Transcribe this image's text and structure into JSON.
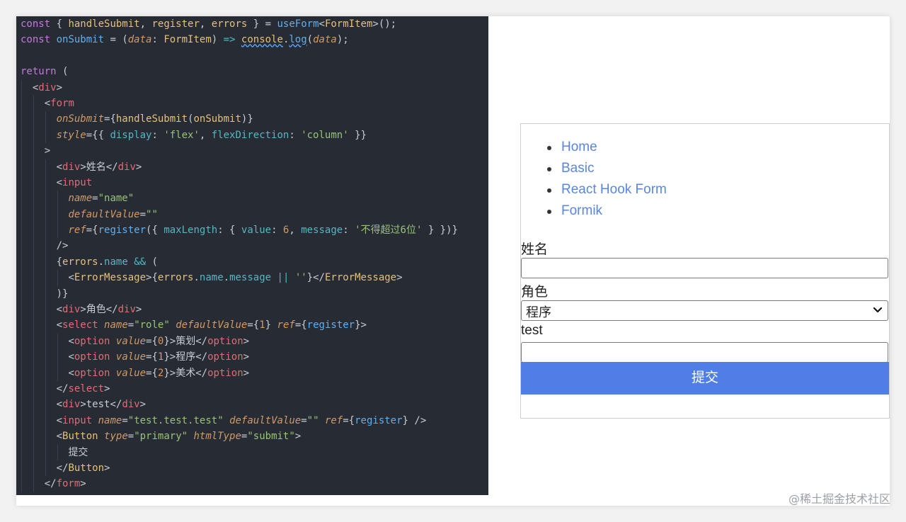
{
  "code": {
    "lines": [
      {
        "segs": [
          {
            "c": "kw",
            "t": "const"
          },
          {
            "c": "plain",
            "t": " { "
          },
          {
            "c": "var",
            "t": "handleSubmit"
          },
          {
            "c": "plain",
            "t": ", "
          },
          {
            "c": "var",
            "t": "register"
          },
          {
            "c": "plain",
            "t": ", "
          },
          {
            "c": "var",
            "t": "errors"
          },
          {
            "c": "plain",
            "t": " } = "
          },
          {
            "c": "fn",
            "t": "useForm"
          },
          {
            "c": "plain",
            "t": "<"
          },
          {
            "c": "var",
            "t": "FormItem"
          },
          {
            "c": "plain",
            "t": ">();"
          }
        ]
      },
      {
        "segs": [
          {
            "c": "kw",
            "t": "const"
          },
          {
            "c": "plain",
            "t": " "
          },
          {
            "c": "fn",
            "t": "onSubmit"
          },
          {
            "c": "plain",
            "t": " = ("
          },
          {
            "c": "attr",
            "t": "data"
          },
          {
            "c": "plain",
            "t": ": "
          },
          {
            "c": "var",
            "t": "FormItem"
          },
          {
            "c": "plain",
            "t": ") "
          },
          {
            "c": "op",
            "t": "=>"
          },
          {
            "c": "plain",
            "t": " "
          },
          {
            "c": "var",
            "t": "console"
          },
          {
            "c": "plain",
            "t": "."
          },
          {
            "c": "fn",
            "t": "log"
          },
          {
            "c": "plain",
            "t": "("
          },
          {
            "c": "attr",
            "t": "data"
          },
          {
            "c": "plain",
            "t": ");"
          }
        ]
      },
      {
        "segs": []
      },
      {
        "segs": [
          {
            "c": "kw",
            "t": "return"
          },
          {
            "c": "plain",
            "t": " ("
          }
        ]
      },
      {
        "indent": 1,
        "segs": [
          {
            "c": "plain",
            "t": "<"
          },
          {
            "c": "tag",
            "t": "div"
          },
          {
            "c": "plain",
            "t": ">"
          }
        ]
      },
      {
        "indent": 2,
        "segs": [
          {
            "c": "plain",
            "t": "<"
          },
          {
            "c": "tag",
            "t": "form"
          }
        ]
      },
      {
        "indent": 3,
        "segs": [
          {
            "c": "attr",
            "t": "onSubmit"
          },
          {
            "c": "plain",
            "t": "={"
          },
          {
            "c": "var",
            "t": "handleSubmit"
          },
          {
            "c": "plain",
            "t": "("
          },
          {
            "c": "var",
            "t": "onSubmit"
          },
          {
            "c": "plain",
            "t": ")}"
          }
        ]
      },
      {
        "indent": 3,
        "segs": [
          {
            "c": "attr",
            "t": "style"
          },
          {
            "c": "plain",
            "t": "={{ "
          },
          {
            "c": "prop",
            "t": "display"
          },
          {
            "c": "plain",
            "t": ": "
          },
          {
            "c": "str",
            "t": "'flex'"
          },
          {
            "c": "plain",
            "t": ", "
          },
          {
            "c": "prop",
            "t": "flexDirection"
          },
          {
            "c": "plain",
            "t": ": "
          },
          {
            "c": "str",
            "t": "'column'"
          },
          {
            "c": "plain",
            "t": " }}"
          }
        ]
      },
      {
        "indent": 2,
        "segs": [
          {
            "c": "plain",
            "t": ">"
          }
        ]
      },
      {
        "indent": 3,
        "segs": [
          {
            "c": "plain",
            "t": "<"
          },
          {
            "c": "tag",
            "t": "div"
          },
          {
            "c": "plain",
            "t": ">姓名</"
          },
          {
            "c": "tag",
            "t": "div"
          },
          {
            "c": "plain",
            "t": ">"
          }
        ]
      },
      {
        "indent": 3,
        "segs": [
          {
            "c": "plain",
            "t": "<"
          },
          {
            "c": "tag",
            "t": "input"
          }
        ]
      },
      {
        "indent": 4,
        "segs": [
          {
            "c": "attr",
            "t": "name"
          },
          {
            "c": "plain",
            "t": "="
          },
          {
            "c": "str",
            "t": "\"name\""
          }
        ]
      },
      {
        "indent": 4,
        "segs": [
          {
            "c": "attr",
            "t": "defaultValue"
          },
          {
            "c": "plain",
            "t": "="
          },
          {
            "c": "str",
            "t": "\"\""
          }
        ]
      },
      {
        "indent": 4,
        "segs": [
          {
            "c": "attr",
            "t": "ref"
          },
          {
            "c": "plain",
            "t": "={"
          },
          {
            "c": "fn",
            "t": "register"
          },
          {
            "c": "plain",
            "t": "({ "
          },
          {
            "c": "prop",
            "t": "maxLength"
          },
          {
            "c": "plain",
            "t": ": { "
          },
          {
            "c": "prop",
            "t": "value"
          },
          {
            "c": "plain",
            "t": ": "
          },
          {
            "c": "num",
            "t": "6"
          },
          {
            "c": "plain",
            "t": ", "
          },
          {
            "c": "prop",
            "t": "message"
          },
          {
            "c": "plain",
            "t": ": "
          },
          {
            "c": "str",
            "t": "'不得超过6位'"
          },
          {
            "c": "plain",
            "t": " } })}"
          }
        ]
      },
      {
        "indent": 3,
        "segs": [
          {
            "c": "plain",
            "t": "/>"
          }
        ]
      },
      {
        "indent": 3,
        "segs": [
          {
            "c": "plain",
            "t": "{"
          },
          {
            "c": "var",
            "t": "errors"
          },
          {
            "c": "plain",
            "t": "."
          },
          {
            "c": "prop",
            "t": "name"
          },
          {
            "c": "plain",
            "t": " "
          },
          {
            "c": "op",
            "t": "&&"
          },
          {
            "c": "plain",
            "t": " ("
          }
        ]
      },
      {
        "indent": 4,
        "segs": [
          {
            "c": "plain",
            "t": "<"
          },
          {
            "c": "var",
            "t": "ErrorMessage"
          },
          {
            "c": "plain",
            "t": ">{"
          },
          {
            "c": "var",
            "t": "errors"
          },
          {
            "c": "plain",
            "t": "."
          },
          {
            "c": "prop",
            "t": "name"
          },
          {
            "c": "plain",
            "t": "."
          },
          {
            "c": "prop",
            "t": "message"
          },
          {
            "c": "plain",
            "t": " "
          },
          {
            "c": "op",
            "t": "||"
          },
          {
            "c": "plain",
            "t": " "
          },
          {
            "c": "str",
            "t": "''"
          },
          {
            "c": "plain",
            "t": "}</"
          },
          {
            "c": "var",
            "t": "ErrorMessage"
          },
          {
            "c": "plain",
            "t": ">"
          }
        ]
      },
      {
        "indent": 3,
        "segs": [
          {
            "c": "plain",
            "t": ")}"
          }
        ]
      },
      {
        "indent": 3,
        "segs": [
          {
            "c": "plain",
            "t": "<"
          },
          {
            "c": "tag",
            "t": "div"
          },
          {
            "c": "plain",
            "t": ">角色</"
          },
          {
            "c": "tag",
            "t": "div"
          },
          {
            "c": "plain",
            "t": ">"
          }
        ]
      },
      {
        "indent": 3,
        "segs": [
          {
            "c": "plain",
            "t": "<"
          },
          {
            "c": "tag",
            "t": "select"
          },
          {
            "c": "plain",
            "t": " "
          },
          {
            "c": "attr",
            "t": "name"
          },
          {
            "c": "plain",
            "t": "="
          },
          {
            "c": "str",
            "t": "\"role\""
          },
          {
            "c": "plain",
            "t": " "
          },
          {
            "c": "attr",
            "t": "defaultValue"
          },
          {
            "c": "plain",
            "t": "={"
          },
          {
            "c": "num",
            "t": "1"
          },
          {
            "c": "plain",
            "t": "} "
          },
          {
            "c": "attr",
            "t": "ref"
          },
          {
            "c": "plain",
            "t": "={"
          },
          {
            "c": "fn",
            "t": "register"
          },
          {
            "c": "plain",
            "t": "}>"
          }
        ]
      },
      {
        "indent": 4,
        "segs": [
          {
            "c": "plain",
            "t": "<"
          },
          {
            "c": "tag",
            "t": "option"
          },
          {
            "c": "plain",
            "t": " "
          },
          {
            "c": "attr",
            "t": "value"
          },
          {
            "c": "plain",
            "t": "={"
          },
          {
            "c": "num",
            "t": "0"
          },
          {
            "c": "plain",
            "t": "}>策划</"
          },
          {
            "c": "tag",
            "t": "option"
          },
          {
            "c": "plain",
            "t": ">"
          }
        ]
      },
      {
        "indent": 4,
        "segs": [
          {
            "c": "plain",
            "t": "<"
          },
          {
            "c": "tag",
            "t": "option"
          },
          {
            "c": "plain",
            "t": " "
          },
          {
            "c": "attr",
            "t": "value"
          },
          {
            "c": "plain",
            "t": "={"
          },
          {
            "c": "num",
            "t": "1"
          },
          {
            "c": "plain",
            "t": "}>程序</"
          },
          {
            "c": "tag",
            "t": "option"
          },
          {
            "c": "plain",
            "t": ">"
          }
        ]
      },
      {
        "indent": 4,
        "segs": [
          {
            "c": "plain",
            "t": "<"
          },
          {
            "c": "tag",
            "t": "option"
          },
          {
            "c": "plain",
            "t": " "
          },
          {
            "c": "attr",
            "t": "value"
          },
          {
            "c": "plain",
            "t": "={"
          },
          {
            "c": "num",
            "t": "2"
          },
          {
            "c": "plain",
            "t": "}>美术</"
          },
          {
            "c": "tag",
            "t": "option"
          },
          {
            "c": "plain",
            "t": ">"
          }
        ]
      },
      {
        "indent": 3,
        "segs": [
          {
            "c": "plain",
            "t": "</"
          },
          {
            "c": "tag",
            "t": "select"
          },
          {
            "c": "plain",
            "t": ">"
          }
        ]
      },
      {
        "indent": 3,
        "segs": [
          {
            "c": "plain",
            "t": "<"
          },
          {
            "c": "tag",
            "t": "div"
          },
          {
            "c": "plain",
            "t": ">test</"
          },
          {
            "c": "tag",
            "t": "div"
          },
          {
            "c": "plain",
            "t": ">"
          }
        ]
      },
      {
        "indent": 3,
        "segs": [
          {
            "c": "plain",
            "t": "<"
          },
          {
            "c": "tag",
            "t": "input"
          },
          {
            "c": "plain",
            "t": " "
          },
          {
            "c": "attr",
            "t": "name"
          },
          {
            "c": "plain",
            "t": "="
          },
          {
            "c": "str",
            "t": "\"test.test.test\""
          },
          {
            "c": "plain",
            "t": " "
          },
          {
            "c": "attr",
            "t": "defaultValue"
          },
          {
            "c": "plain",
            "t": "="
          },
          {
            "c": "str",
            "t": "\"\""
          },
          {
            "c": "plain",
            "t": " "
          },
          {
            "c": "attr",
            "t": "ref"
          },
          {
            "c": "plain",
            "t": "={"
          },
          {
            "c": "fn",
            "t": "register"
          },
          {
            "c": "plain",
            "t": "} />"
          }
        ]
      },
      {
        "indent": 3,
        "segs": [
          {
            "c": "plain",
            "t": "<"
          },
          {
            "c": "var",
            "t": "Button"
          },
          {
            "c": "plain",
            "t": " "
          },
          {
            "c": "attr",
            "t": "type"
          },
          {
            "c": "plain",
            "t": "="
          },
          {
            "c": "str",
            "t": "\"primary\""
          },
          {
            "c": "plain",
            "t": " "
          },
          {
            "c": "attr",
            "t": "htmlType"
          },
          {
            "c": "plain",
            "t": "="
          },
          {
            "c": "str",
            "t": "\"submit\""
          },
          {
            "c": "plain",
            "t": ">"
          }
        ]
      },
      {
        "indent": 4,
        "segs": [
          {
            "c": "plain",
            "t": "提交"
          }
        ]
      },
      {
        "indent": 3,
        "segs": [
          {
            "c": "plain",
            "t": "</"
          },
          {
            "c": "var",
            "t": "Button"
          },
          {
            "c": "plain",
            "t": ">"
          }
        ]
      },
      {
        "indent": 2,
        "segs": [
          {
            "c": "plain",
            "t": "</"
          },
          {
            "c": "tag",
            "t": "form"
          },
          {
            "c": "plain",
            "t": ">"
          }
        ]
      }
    ]
  },
  "preview": {
    "nav": [
      "Home",
      "Basic",
      "React Hook Form",
      "Formik"
    ],
    "name_label": "姓名",
    "name_value": "",
    "role_label": "角色",
    "role_selected": "程序",
    "test_label": "test",
    "test_value": "",
    "submit_label": "提交"
  },
  "watermark": "@稀土掘金技术社区",
  "colors": {
    "code_bg": "#272b33",
    "link": "#5885e6",
    "button": "#4f7ee6"
  }
}
